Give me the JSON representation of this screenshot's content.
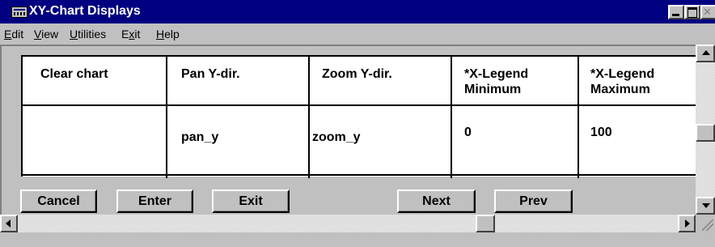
{
  "window": {
    "title": "XY-Chart Displays"
  },
  "menu": {
    "items": [
      {
        "underline": "E",
        "rest": "dit"
      },
      {
        "underline": "V",
        "rest": "iew"
      },
      {
        "underline": "U",
        "rest": "tilities"
      },
      {
        "prefix": "E",
        "underline": "x",
        "rest": "it"
      },
      {
        "underline": "H",
        "rest": "elp"
      }
    ]
  },
  "table": {
    "headers": [
      "Clear chart",
      "Pan Y-dir.",
      "Zoom Y-dir.",
      "*X-Legend",
      "Minimum",
      "*X-Legend",
      "Maximum"
    ],
    "values": [
      "",
      "pan_y",
      "zoom_y",
      "0",
      "100"
    ]
  },
  "buttons": {
    "cancel": "Cancel",
    "enter": "Enter",
    "exit": "Exit",
    "next": "Next",
    "prev": "Prev"
  },
  "colors": {
    "titlebar": "#000080",
    "face": "#c0c0c0"
  }
}
